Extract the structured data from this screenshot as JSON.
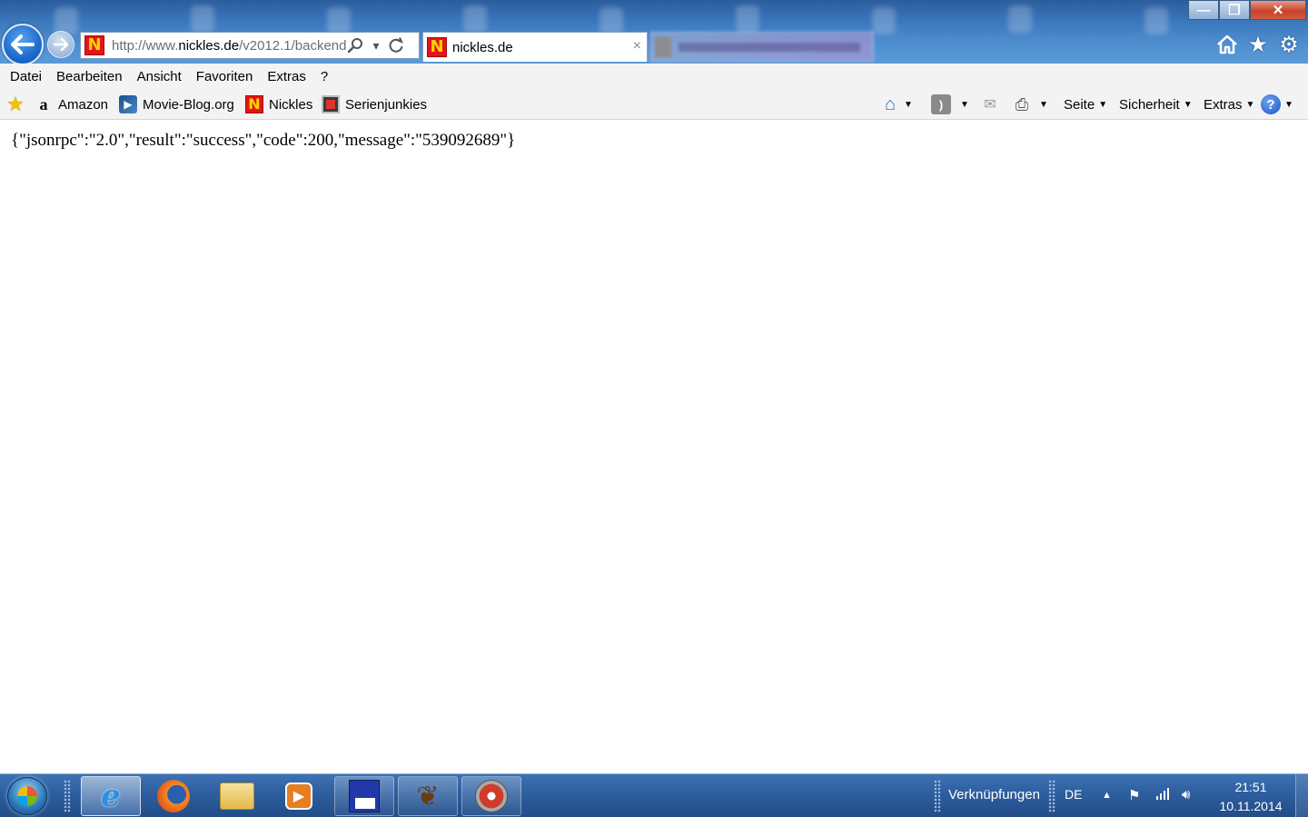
{
  "browser": {
    "address_url_prefix": "http://www.",
    "address_url_domain": "nickles.de",
    "address_url_suffix": "/v2012.1/backend",
    "active_tab_title": "nickles.de",
    "tab_close_glyph": "×"
  },
  "window_controls": {
    "minimize": "—",
    "maximize": "❐",
    "close": "✕"
  },
  "toolbar_icons": [
    "home-icon",
    "favorites-star-icon",
    "settings-gear-icon"
  ],
  "menu": [
    "Datei",
    "Bearbeiten",
    "Ansicht",
    "Favoriten",
    "Extras",
    "?"
  ],
  "favorites": [
    {
      "label": "Amazon",
      "icon": "amazon-icon"
    },
    {
      "label": "Movie-Blog.org",
      "icon": "movie-blog-icon"
    },
    {
      "label": "Nickles",
      "icon": "nickles-icon"
    },
    {
      "label": "Serienjunkies",
      "icon": "serienjunkies-icon"
    }
  ],
  "command_bar": {
    "page_label": "Seite",
    "security_label": "Sicherheit",
    "tools_label": "Extras"
  },
  "content": {
    "json_response": "{\"jsonrpc\":\"2.0\",\"result\":\"success\",\"code\":200,\"message\":\"539092689\"}"
  },
  "taskbar": {
    "apps": [
      "internet-explorer",
      "firefox",
      "explorer",
      "media-player",
      "save-tool",
      "tree-app",
      "cd-burner"
    ],
    "links_toolbar_label": "Verknüpfungen",
    "language": "DE",
    "time": "21:51",
    "date": "10.11.2014"
  },
  "colors": {
    "title_bar": "#3b78bd",
    "taskbar": "#2d5e9e",
    "nickles_red": "#e3141b",
    "nickles_yellow": "#ffd400"
  }
}
